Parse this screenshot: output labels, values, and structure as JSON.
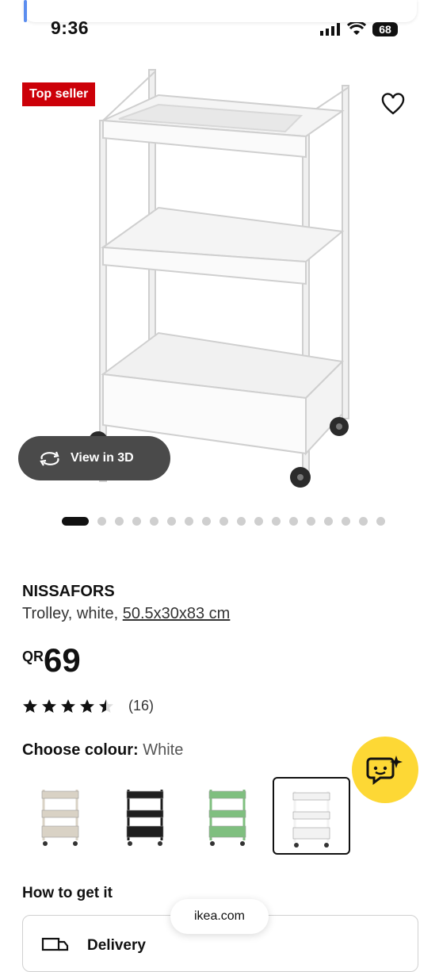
{
  "status_bar": {
    "time": "9:36",
    "battery": "68"
  },
  "hero": {
    "badge": "Top seller",
    "view_3d_label": "View in 3D",
    "carousel": {
      "total": 18,
      "active_index": 0
    }
  },
  "product": {
    "name": "NISSAFORS",
    "description": "Trolley, white, ",
    "dimensions": "50.5x30x83 cm",
    "currency": "QR",
    "price": "69",
    "rating": {
      "value": 4.5,
      "max": 5,
      "count": "(16)"
    }
  },
  "colour": {
    "label": "Choose colour:",
    "value": "White",
    "options": [
      {
        "name": "beige",
        "color": "#d9d2c5",
        "selected": false
      },
      {
        "name": "black",
        "color": "#1e1e1e",
        "selected": false
      },
      {
        "name": "green",
        "color": "#7fbf7f",
        "selected": false
      },
      {
        "name": "white",
        "color": "#f2f2f2",
        "selected": true
      }
    ]
  },
  "how_to_get": {
    "heading": "How to get it",
    "delivery_label": "Delivery"
  },
  "browser": {
    "url": "ikea.com"
  },
  "colors": {
    "badge": "#cc0008",
    "chat": "#fdd835"
  }
}
